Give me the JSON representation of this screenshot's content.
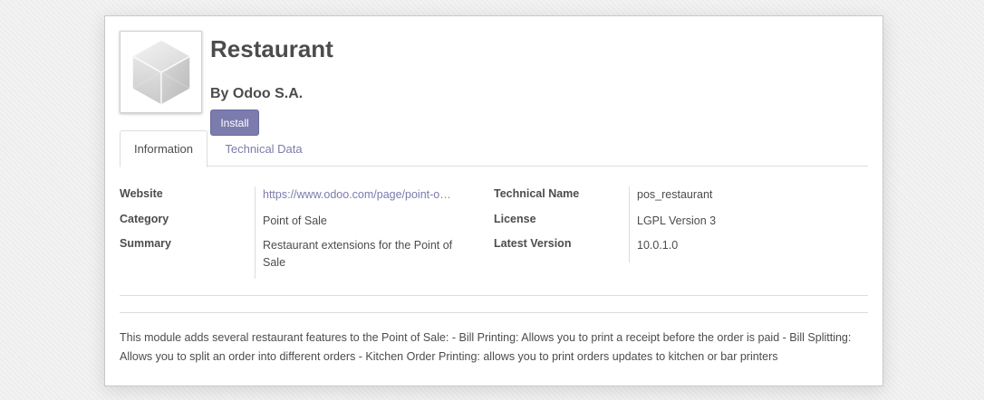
{
  "module": {
    "title": "Restaurant",
    "author": "By Odoo S.A.",
    "install_label": "Install",
    "icon": "cube-icon"
  },
  "tabs": [
    {
      "label": "Information",
      "active": true
    },
    {
      "label": "Technical Data",
      "active": false
    }
  ],
  "info": {
    "website_label": "Website",
    "website_value": "https://www.odoo.com/page/point-o…",
    "category_label": "Category",
    "category_value": "Point of Sale",
    "summary_label": "Summary",
    "summary_value": "Restaurant extensions for the Point of Sale",
    "technical_name_label": "Technical Name",
    "technical_name_value": "pos_restaurant",
    "license_label": "License",
    "license_value": "LGPL Version 3",
    "latest_version_label": "Latest Version",
    "latest_version_value": "10.0.1.0"
  },
  "description": "This module adds several restaurant features to the Point of Sale: - Bill Printing: Allows you to print a receipt before the order is paid - Bill Splitting: Allows you to split an order into different orders - Kitchen Order Printing: allows you to print orders updates to kitchen or bar printers",
  "colors": {
    "accent": "#7c7bad",
    "text": "#4c4c4c",
    "border": "#dddddd"
  }
}
